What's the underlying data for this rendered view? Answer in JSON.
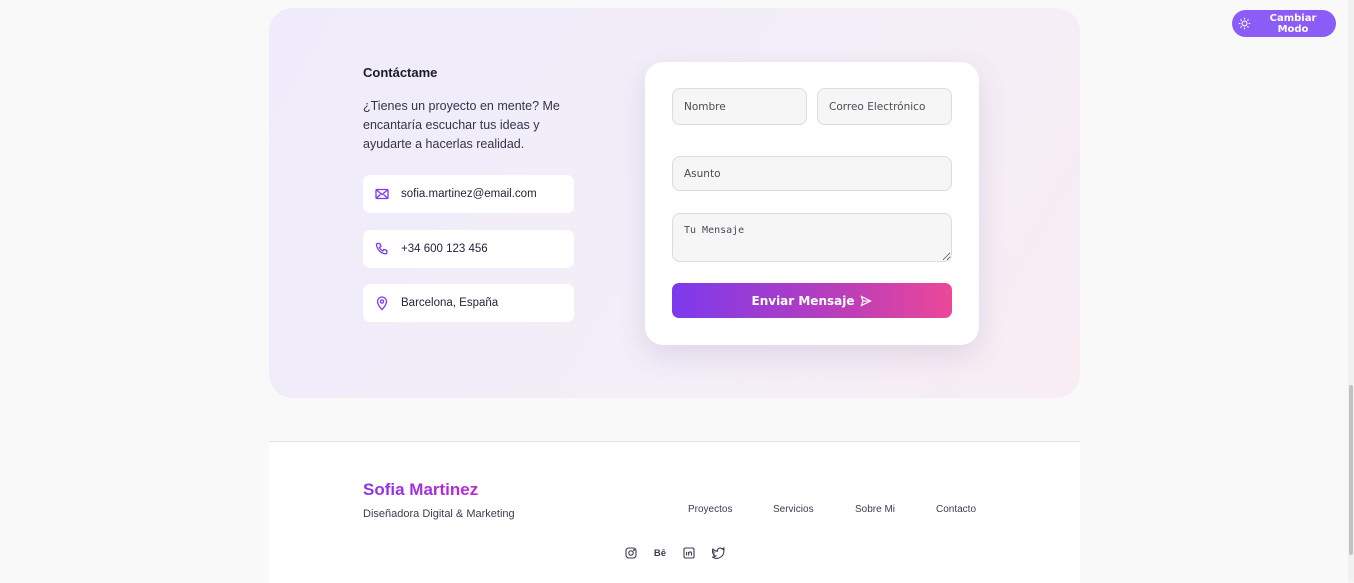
{
  "theme_toggle": {
    "label": "Cambiar Modo",
    "icon": "sun-icon"
  },
  "contact": {
    "title": "Contáctame",
    "description": "¿Tienes un proyecto en mente? Me encantaría escuchar tus ideas y ayudarte a hacerlas realidad.",
    "info": [
      {
        "icon": "mail-icon",
        "text": "sofia.martinez@email.com"
      },
      {
        "icon": "phone-icon",
        "text": "+34 600 123 456"
      },
      {
        "icon": "location-pin-icon",
        "text": "Barcelona, España"
      }
    ],
    "accent_color": "#7c3aed"
  },
  "form": {
    "name_placeholder": "Nombre",
    "email_placeholder": "Correo Electrónico",
    "subject_placeholder": "Asunto",
    "message_placeholder": "Tu Mensaje",
    "submit_label": "Enviar Mensaje",
    "submit_icon": "send-icon",
    "gradient": [
      "#7c3aed",
      "#ec4899"
    ]
  },
  "footer": {
    "brand": "Sofia Martinez",
    "tagline": "Diseñadora Digital & Marketing",
    "nav": [
      "Proyectos",
      "Servicios",
      "Sobre Mi",
      "Contacto"
    ],
    "socials": [
      {
        "icon": "instagram-icon"
      },
      {
        "icon": "behance-icon",
        "text": "Bē"
      },
      {
        "icon": "linkedin-icon"
      },
      {
        "icon": "twitter-icon"
      }
    ]
  }
}
